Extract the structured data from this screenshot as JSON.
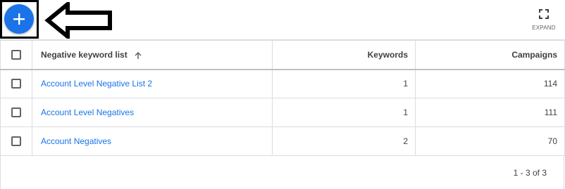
{
  "toolbar": {
    "add_icon": "plus-icon",
    "annotation_icon": "arrow-left-icon",
    "expand_icon": "fullscreen-icon",
    "expand_label": "EXPAND"
  },
  "table": {
    "columns": {
      "name": "Negative keyword list",
      "name_sort_icon": "arrow-up-icon",
      "keywords": "Keywords",
      "campaigns": "Campaigns"
    },
    "rows": [
      {
        "name": "Account Level Negative List 2",
        "keywords": "1",
        "campaigns": "114"
      },
      {
        "name": "Account Level Negatives",
        "keywords": "1",
        "campaigns": "111"
      },
      {
        "name": "Account Negatives",
        "keywords": "2",
        "campaigns": "70"
      }
    ]
  },
  "pagination": {
    "text": "1 - 3 of 3"
  },
  "colors": {
    "accent": "#1a73e8",
    "annotation": "#000000"
  }
}
